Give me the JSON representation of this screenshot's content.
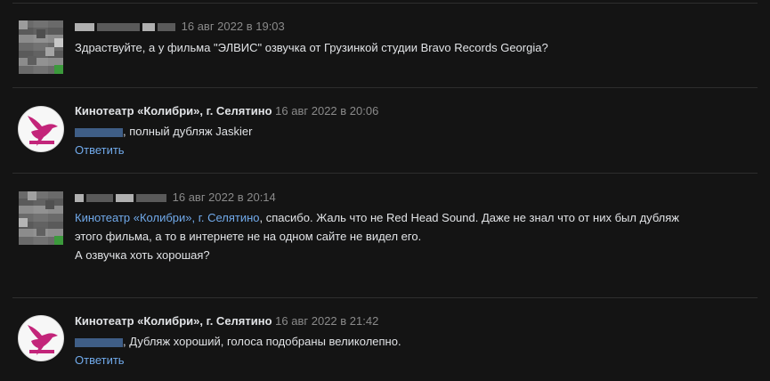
{
  "comments": [
    {
      "author": "",
      "date": "16 авг 2022 в 19:03",
      "mention": "",
      "text_lines": [
        "Здраствуйте, а у фильма \"ЭЛВИС\" озвучка от Грузинкой студии Bravo Records Georgia?"
      ],
      "reply_label": ""
    },
    {
      "author": "Кинотеатр «Колибри», г. Селятино",
      "date": "16 авг 2022 в 20:06",
      "mention": "",
      "text_lines": [
        ", полный дубляж Jaskier"
      ],
      "reply_label": "Ответить"
    },
    {
      "author": "",
      "date": "16 авг 2022 в 20:14",
      "mention": "Кинотеатр «Колибри», г. Селятино",
      "text_lines": [
        ", спасибо. Жаль что не Red Head Sound. Даже не знал что от них был дубляж",
        "этого фильма, а то в интернете не на одном сайте не видел его.",
        "А озвучка хоть хорошая?"
      ],
      "reply_label": ""
    },
    {
      "author": "Кинотеатр «Колибри», г. Селятино",
      "date": "16 авг 2022 в 21:42",
      "mention": "",
      "text_lines": [
        ", Дубляж хороший, голоса подобраны великолепно."
      ],
      "reply_label": "Ответить"
    }
  ],
  "colors": {
    "background": "#141414",
    "text": "#e1e3e6",
    "muted": "#8a8a8a",
    "link": "#71aaeb",
    "divider": "#2e2e2e",
    "logo_pink": "#c3257a"
  },
  "icons": {
    "hummingbird_logo": "hummingbird-logo-icon"
  }
}
